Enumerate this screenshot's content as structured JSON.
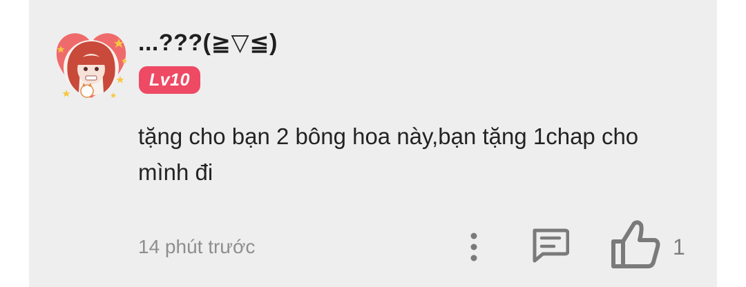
{
  "comment": {
    "username": "...???(≧▽≦)",
    "level_badge": "Lv10",
    "text": "tặng cho bạn 2 bông hoa này,bạn tặng 1chap cho mình đi",
    "timestamp": "14 phút trước",
    "like_count": "1"
  },
  "icons": {
    "more": "more-vertical-icon",
    "reply": "comment-reply-icon",
    "like": "thumbs-up-icon"
  },
  "colors": {
    "card_background": "#eeeeef",
    "level_badge": "#ee4a64",
    "icon_gray": "#7a7a7a",
    "timestamp": "#8e8e8e"
  }
}
